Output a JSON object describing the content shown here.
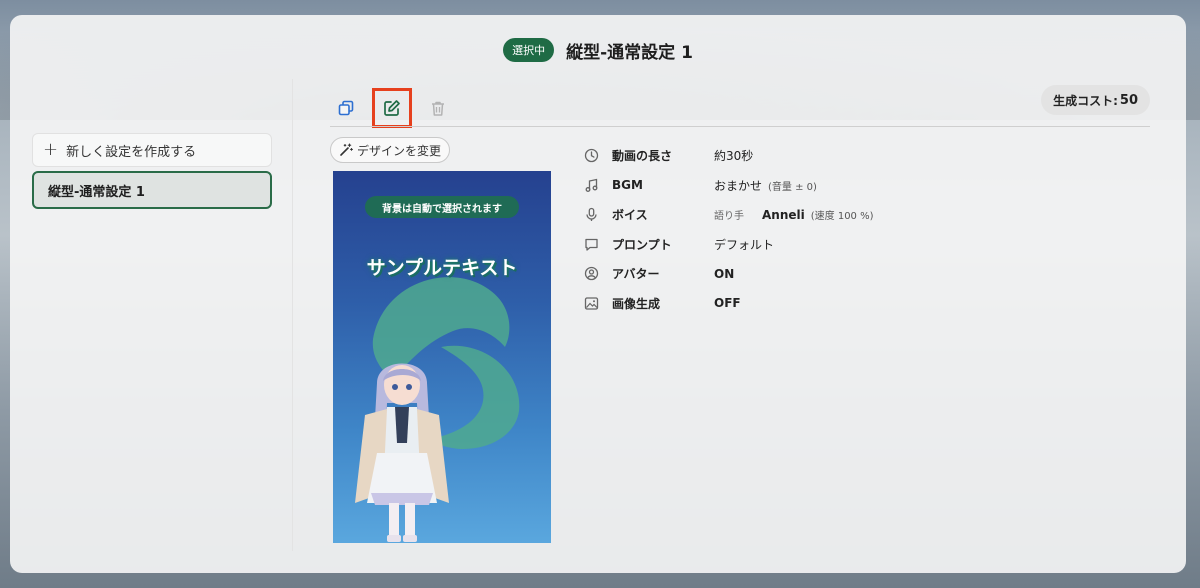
{
  "header": {
    "badge": "選択中",
    "title": "縦型-通常設定 1"
  },
  "sidebar": {
    "new_button_label": "新しく設定を作成する",
    "items": [
      {
        "label": "縦型-通常設定 1",
        "selected": true
      }
    ]
  },
  "toolbar": {
    "icons": [
      "copy-icon",
      "edit-icon",
      "trash-icon"
    ],
    "highlighted": "edit-icon",
    "cost_label": "生成コスト:",
    "cost_value": "50"
  },
  "design": {
    "change_button_label": "デザインを変更",
    "preview_chip": "背景は自動で選択されます",
    "preview_text": "サンプルテキスト"
  },
  "info": [
    {
      "icon": "clock-icon",
      "label": "動画の長さ",
      "value": "約30秒"
    },
    {
      "icon": "music-note-icon",
      "label": "BGM",
      "value": "おまかせ",
      "sub": "(音量 ± 0)"
    },
    {
      "icon": "microphone-icon",
      "label": "ボイス",
      "prefix": "語り手",
      "value": "Anneli",
      "sub": "(速度 100 %)"
    },
    {
      "icon": "chat-icon",
      "label": "プロンプト",
      "value": "デフォルト"
    },
    {
      "icon": "avatar-icon",
      "label": "アバター",
      "value": "ON"
    },
    {
      "icon": "image-icon",
      "label": "画像生成",
      "value": "OFF"
    }
  ],
  "colors": {
    "accent": "#1f6b45",
    "highlight_border": "#e6401d",
    "icon_blue": "#2d6fd1"
  }
}
